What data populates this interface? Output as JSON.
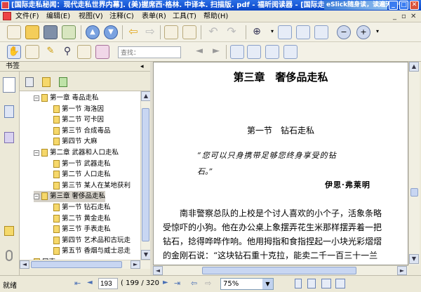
{
  "window": {
    "title": "[国际走私秘闻：现代走私世界内幕]. (美)握席西·格林. 中译本. 扫描版. pdf - 福昕阅读器 - [国际走...",
    "banner": "eSlick随身读，读遍天下书！"
  },
  "menu": [
    "文件(F)",
    "编辑(E)",
    "视图(V)",
    "注释(C)",
    "表单(R)",
    "工具(T)",
    "帮助(H)"
  ],
  "toolbar": {
    "search_placeholder": "查找："
  },
  "sidebar": {
    "title": "书签",
    "pin": "✕",
    "bookmarks": [
      {
        "label": "第一章  毒品走私",
        "level": 0,
        "toggle": "−"
      },
      {
        "label": "第一节  海洛因",
        "level": 1
      },
      {
        "label": "第二节  可卡因",
        "level": 1
      },
      {
        "label": "第三节  合成毒品",
        "level": 1
      },
      {
        "label": "第四节  大麻",
        "level": 1
      },
      {
        "label": "第二章  武器和人口走私",
        "level": 0,
        "toggle": "−"
      },
      {
        "label": "第一节  武器走私",
        "level": 1
      },
      {
        "label": "第二节  人口走私",
        "level": 1
      },
      {
        "label": "第三节  某人在某地获利",
        "level": 1
      },
      {
        "label": "第三章  奢侈品走私",
        "level": 0,
        "toggle": "−",
        "selected": true
      },
      {
        "label": "第一节  钻石走私",
        "level": 1
      },
      {
        "label": "第二节  黄金走私",
        "level": 1
      },
      {
        "label": "第三节  手表走私",
        "level": 1
      },
      {
        "label": "第四节  艺术品和古玩走",
        "level": 1
      },
      {
        "label": "第五节  香烟与威士忌走",
        "level": 1
      },
      {
        "label": "尾声",
        "level": 0
      }
    ]
  },
  "document": {
    "chapter_title": "第三章　奢侈品走私",
    "section_title": "第一节　钻石走私",
    "quote_line1": "“您可以只身携带足够您终身享受的钻",
    "quote_line2": "石。”",
    "attribution": "伊思·弗莱明",
    "body": [
      "南非警察总队的上校是个讨人喜欢的小个子，活象条略",
      "受惊吓的小狗。他在办公桌上象摆弄花生米那样摆弄着一把",
      "钻石，捻得哗哗作响。他用拇指和食指捏起一小块光彩熠熠",
      "的金刚石说：“这块钻石重十克拉，能卖二千一百三十一兰"
    ]
  },
  "status": {
    "ready": "就绪",
    "page_current": "193",
    "page_info": "( 199 / 320 )",
    "zoom": "75%"
  }
}
